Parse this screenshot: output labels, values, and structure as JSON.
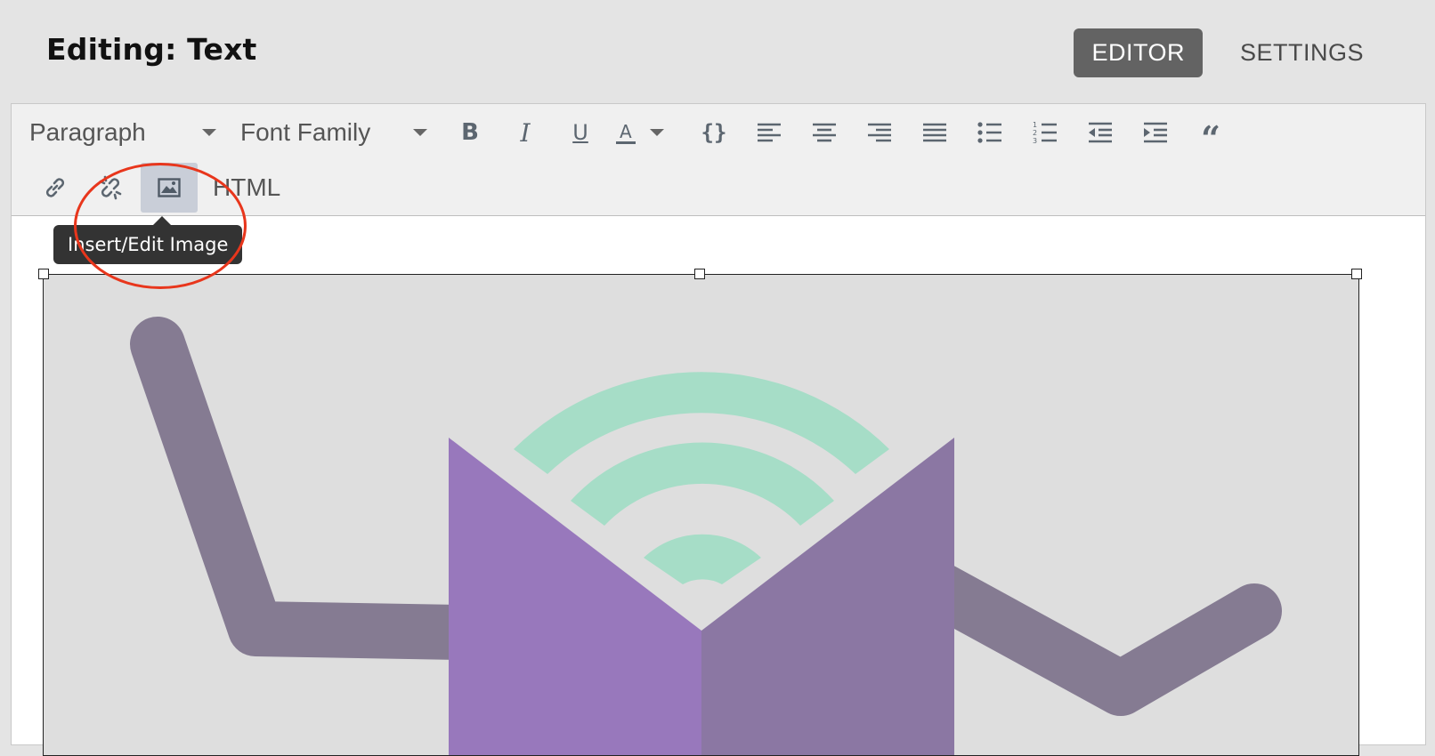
{
  "header": {
    "title": "Editing: Text",
    "tabs": [
      {
        "label": "EDITOR",
        "active": true
      },
      {
        "label": "SETTINGS",
        "active": false
      }
    ]
  },
  "toolbar": {
    "block_format": "Paragraph",
    "font_family": "Font Family",
    "buttons_row1": [
      "bold-icon",
      "italic-icon",
      "underline-icon",
      "text-color-icon",
      "code-icon",
      "align-left-icon",
      "align-center-icon",
      "align-right-icon",
      "align-justify-icon",
      "bullet-list-icon",
      "numbered-list-icon",
      "outdent-icon",
      "indent-icon",
      "blockquote-icon"
    ],
    "buttons_row2": [
      "link-icon",
      "unlink-icon",
      "image-icon"
    ],
    "html_label": "HTML"
  },
  "tooltip": {
    "text": "Insert/Edit Image"
  },
  "annotation": {
    "highlight_color": "#e8361c"
  },
  "image": {
    "description_colors": {
      "background": "#dedede",
      "arms": "#857b92",
      "book_left": "#9878bc",
      "book_right": "#8b77a3",
      "signal": "#a6ddc7"
    }
  }
}
